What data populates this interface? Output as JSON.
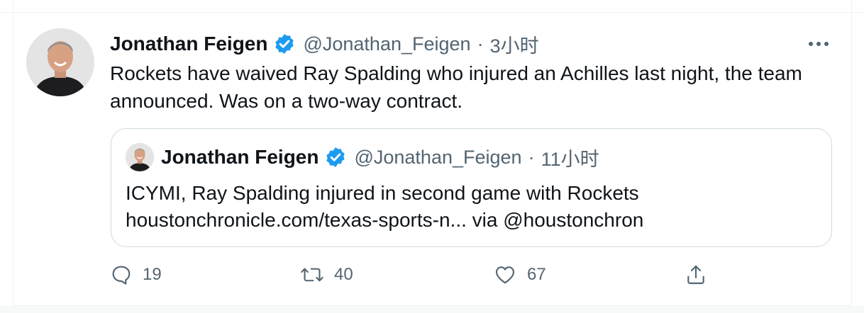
{
  "tweet": {
    "author": {
      "display_name": "Jonathan Feigen",
      "handle": "@Jonathan_Feigen",
      "verified": true
    },
    "separator": "·",
    "timestamp": "3小时",
    "text": "Rockets have waived Ray Spalding who injured an Achilles last night, the team announced. Was on a two-way contract.",
    "quote": {
      "author": {
        "display_name": "Jonathan Feigen",
        "handle": "@Jonathan_Feigen",
        "verified": true
      },
      "separator": "·",
      "timestamp": "11小时",
      "text_line_1": "ICYMI, Ray Spalding injured in second game with Rockets",
      "text_line_2": "houstonchronicle.com/texas-sports-n... via @houstonchron"
    },
    "actions": {
      "reply_count": "19",
      "retweet_count": "40",
      "like_count": "67"
    }
  },
  "icons": {
    "more": "more-horizontal-icon",
    "verified": "verified-badge-icon",
    "reply": "reply-icon",
    "retweet": "retweet-icon",
    "like": "heart-icon",
    "share": "share-icon"
  },
  "colors": {
    "verified_blue": "#1d9bf0",
    "secondary_text": "#536471",
    "primary_text": "#0f1419",
    "border": "#cfd9de"
  }
}
